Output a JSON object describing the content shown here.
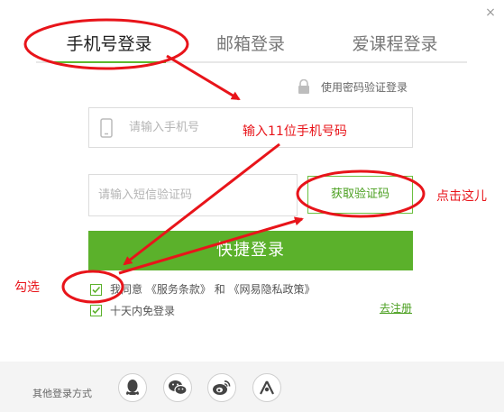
{
  "dialog": {
    "close_glyph": "×"
  },
  "tabs": [
    {
      "label": "手机号登录",
      "active": true
    },
    {
      "label": "邮箱登录",
      "active": false
    },
    {
      "label": "爱课程登录",
      "active": false
    }
  ],
  "password_login": {
    "label": "使用密码验证登录",
    "icon": "lock-icon"
  },
  "phone_input": {
    "placeholder": "请输入手机号",
    "value": "",
    "icon": "mobile-phone-icon"
  },
  "sms_input": {
    "placeholder": "请输入短信验证码",
    "value": ""
  },
  "get_code_button": {
    "label": "获取验证码"
  },
  "login_button": {
    "label": "快捷登录"
  },
  "agreement": {
    "checked": true,
    "prefix": "我同意",
    "terms": "《服务条款》",
    "conjunction": "和",
    "privacy": "《网易隐私政策》"
  },
  "remember": {
    "checked": true,
    "label": "十天内免登录"
  },
  "register_link": {
    "label": "去注册"
  },
  "footer": {
    "label": "其他登录方式",
    "providers": [
      {
        "icon": "qq-icon"
      },
      {
        "icon": "wechat-icon"
      },
      {
        "icon": "weibo-icon"
      },
      {
        "icon": "aicourse-icon"
      }
    ]
  },
  "annotations": {
    "phone_note": "输入11位手机号码",
    "click_note": "点击这儿",
    "check_note": "勾选",
    "color": "#e8141a"
  },
  "colors": {
    "accent": "#5bb12b",
    "link": "#4a9f1f"
  }
}
